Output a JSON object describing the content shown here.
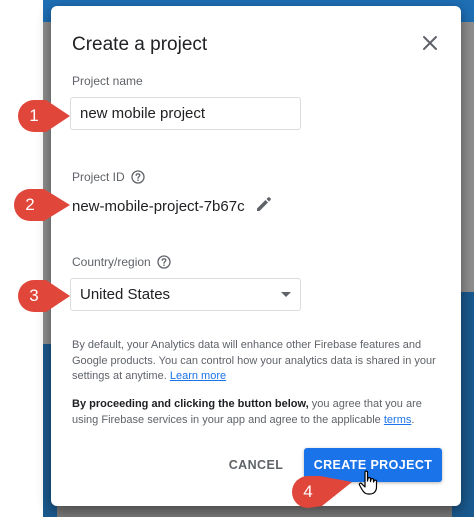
{
  "dialog": {
    "title": "Create a project",
    "close_icon": "close-icon"
  },
  "project_name": {
    "label": "Project name",
    "value": "new mobile project"
  },
  "project_id": {
    "label": "Project ID",
    "value": "new-mobile-project-7b67c",
    "help_icon": "help-circle-icon",
    "edit_icon": "pencil-icon"
  },
  "country": {
    "label": "Country/region",
    "selected": "United States",
    "help_icon": "help-circle-icon",
    "caret_icon": "caret-down-icon"
  },
  "analytics_notice": {
    "text": "By default, your Analytics data will enhance other Firebase features and Google products. You can control how your analytics data is shared in your settings at anytime.",
    "link": "Learn more"
  },
  "terms_notice": {
    "bold": "By proceeding and clicking the button below,",
    "text": "you agree that you are using Firebase services in your app and agree to the applicable",
    "link": "terms",
    "end": "."
  },
  "buttons": {
    "cancel": "CANCEL",
    "create": "CREATE PROJECT"
  },
  "callouts": [
    "1",
    "2",
    "3",
    "4"
  ],
  "colors": {
    "primary": "#1a73e8",
    "callout_red": "#e0463a"
  }
}
